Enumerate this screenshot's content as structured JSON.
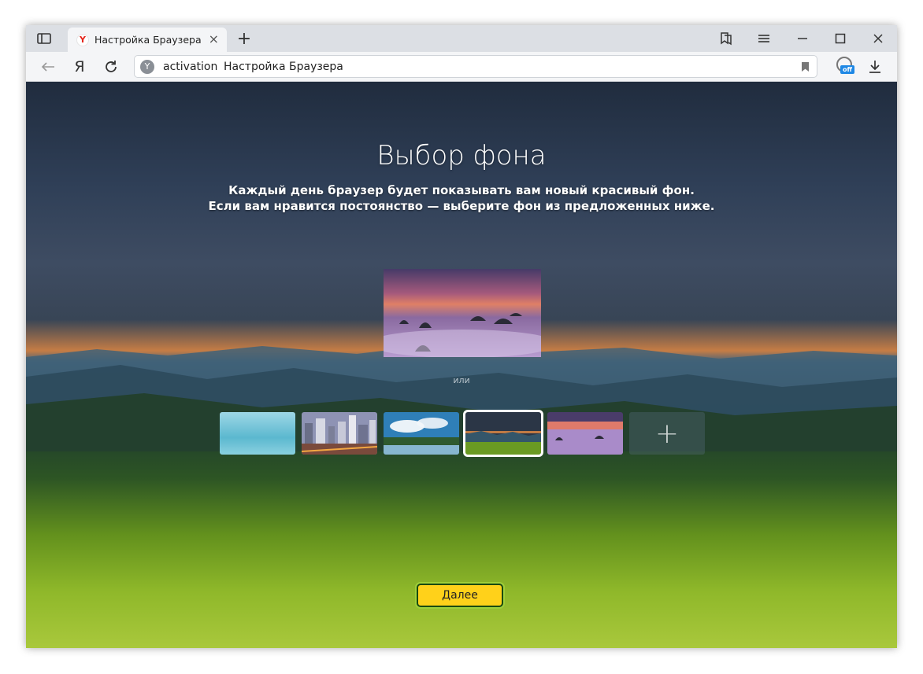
{
  "tab": {
    "title": "Настройка Браузера",
    "favicon": "Y"
  },
  "toolbar": {
    "yandex_label": "Я"
  },
  "address": {
    "domain": "activation",
    "page_title": "Настройка Браузера"
  },
  "turbo": {
    "badge": "off"
  },
  "page": {
    "heading": "Выбор фона",
    "subtitle_line1": "Каждый день браузер будет показывать вам новый красивый фон.",
    "subtitle_line2": "Если вам нравится постоянство — выберите фон из предложенных ниже.",
    "or_label": "или",
    "next_button": "Далее"
  },
  "thumbnails": [
    {
      "name": "sea",
      "selected": false
    },
    {
      "name": "city",
      "selected": false
    },
    {
      "name": "lake",
      "selected": false
    },
    {
      "name": "mountains",
      "selected": true
    },
    {
      "name": "sunset-clouds",
      "selected": false
    }
  ],
  "colors": {
    "accent_button": "#ffd11a",
    "selected_outline": "#ffffff"
  }
}
